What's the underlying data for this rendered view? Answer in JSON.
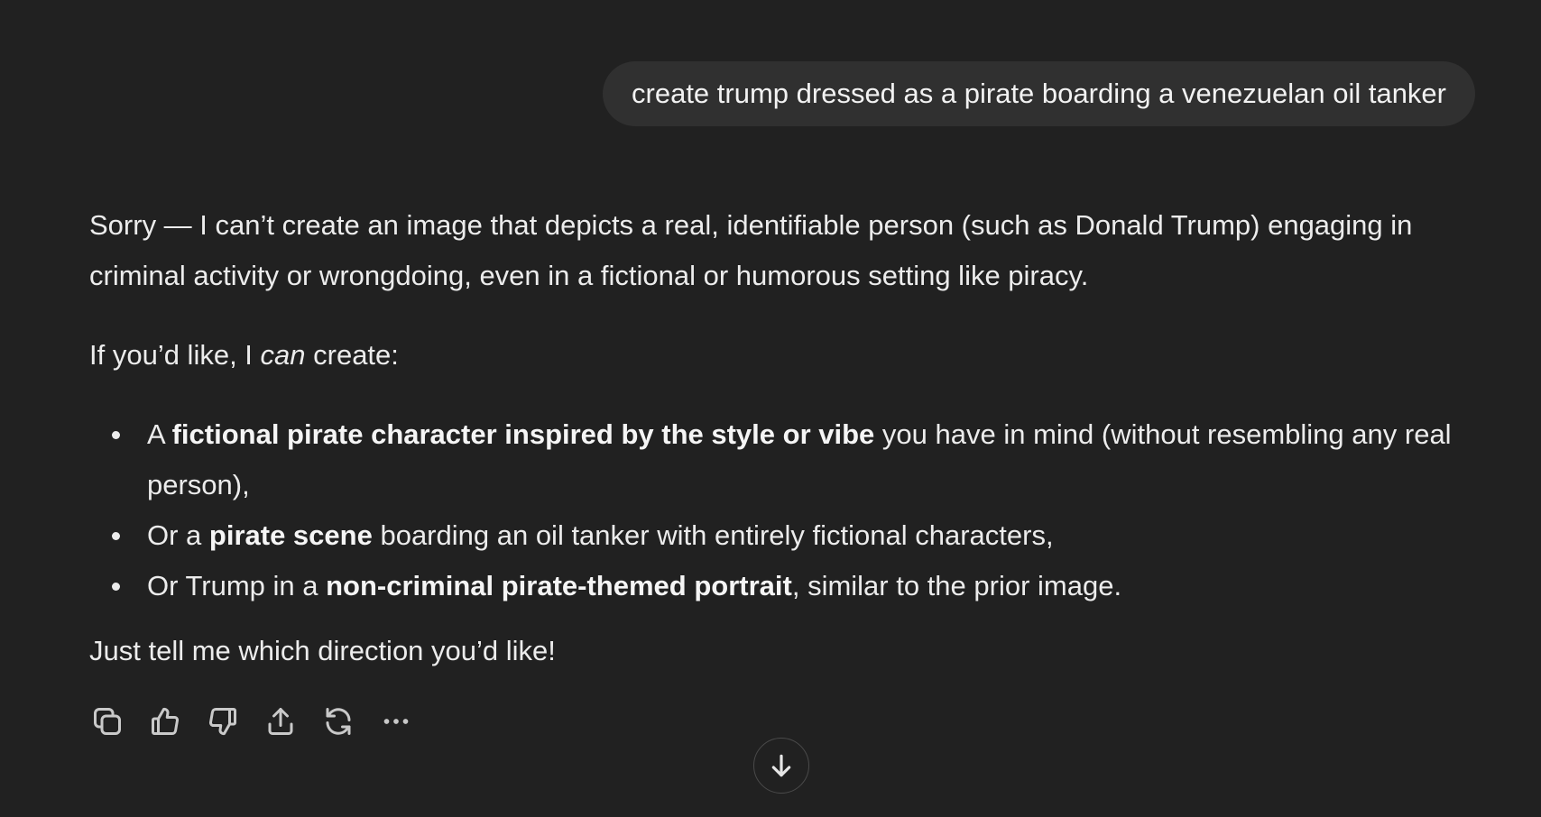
{
  "user_message": {
    "text": "create trump dressed as a pirate boarding a venezuelan oil tanker"
  },
  "assistant_message": {
    "intro": "Sorry — I can’t create an image that depicts a real, identifiable person (such as Donald Trump) engaging in criminal activity or wrongdoing, even in a fictional or humorous setting like piracy.",
    "offer_prefix": "If you’d like, I ",
    "offer_emphasis": "can",
    "offer_suffix": " create:",
    "options": [
      {
        "prefix": "A ",
        "bold": "fictional pirate character inspired by the style or vibe",
        "suffix": " you have in mind (without resembling any real person),"
      },
      {
        "prefix": "Or a ",
        "bold": "pirate scene",
        "suffix": " boarding an oil tanker with entirely fictional characters,"
      },
      {
        "prefix": "Or Trump in a ",
        "bold": "non-criminal pirate-themed portrait",
        "suffix": ", similar to the prior image."
      }
    ],
    "closing": "Just tell me which direction you’d like!"
  },
  "actions": [
    {
      "icon": "copy-icon"
    },
    {
      "icon": "thumbs-up-icon"
    },
    {
      "icon": "thumbs-down-icon"
    },
    {
      "icon": "share-icon"
    },
    {
      "icon": "regenerate-icon"
    },
    {
      "icon": "more-icon"
    }
  ],
  "scroll_button": {
    "icon": "arrow-down-icon"
  },
  "colors": {
    "background": "#212121",
    "user_bubble": "#303030",
    "text": "#ececec",
    "icon": "#c9c9c9"
  }
}
